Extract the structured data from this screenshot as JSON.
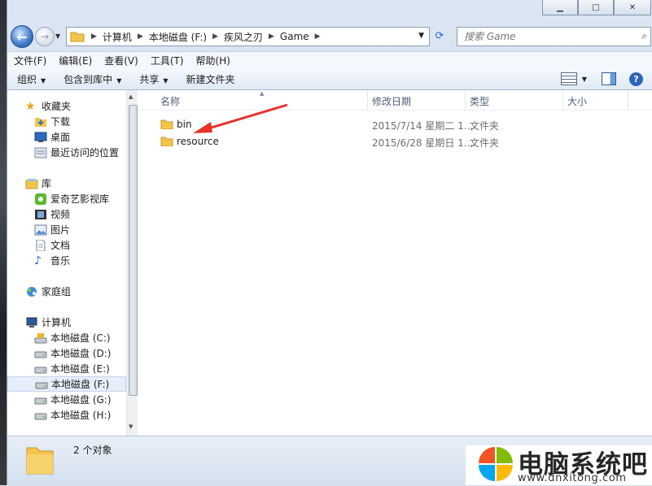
{
  "window": {
    "caption": {
      "minimize": "▁",
      "maximize": "□",
      "close": "✕"
    }
  },
  "address": {
    "segments": [
      "计算机",
      "本地磁盘 (F:)",
      "疾风之刃",
      "Game"
    ]
  },
  "search": {
    "placeholder": "搜索 Game"
  },
  "menu": [
    "文件(F)",
    "编辑(E)",
    "查看(V)",
    "工具(T)",
    "帮助(H)"
  ],
  "toolbar": {
    "organize": "组织",
    "include_library": "包含到库中",
    "share": "共享",
    "new_folder": "新建文件夹"
  },
  "nav": {
    "favorites": "收藏夹",
    "downloads": "下载",
    "desktop": "桌面",
    "recent": "最近访问的位置",
    "libraries": "库",
    "iqiyi": "爱奇艺影视库",
    "videos": "视频",
    "pictures": "图片",
    "documents": "文档",
    "music": "音乐",
    "homegroup": "家庭组",
    "computer": "计算机",
    "drive_c": "本地磁盘 (C:)",
    "drive_d": "本地磁盘 (D:)",
    "drive_e": "本地磁盘 (E:)",
    "drive_f": "本地磁盘 (F:)",
    "drive_g": "本地磁盘 (G:)",
    "drive_h": "本地磁盘 (H:)"
  },
  "columns": {
    "name": "名称",
    "date": "修改日期",
    "type": "类型",
    "size": "大小"
  },
  "files": [
    {
      "name": "bin",
      "date": "2015/7/14 星期二 1...",
      "type": "文件夹"
    },
    {
      "name": "resource",
      "date": "2015/6/28 星期日 1...",
      "type": "文件夹"
    }
  ],
  "status": {
    "count": "2 个对象"
  },
  "watermark": {
    "title": "电脑系统吧",
    "url": "www.dnxitong.com"
  },
  "colors": {
    "accent": "#2d65b8",
    "arrow": "#e8312b",
    "folder": "#f2c54a"
  }
}
